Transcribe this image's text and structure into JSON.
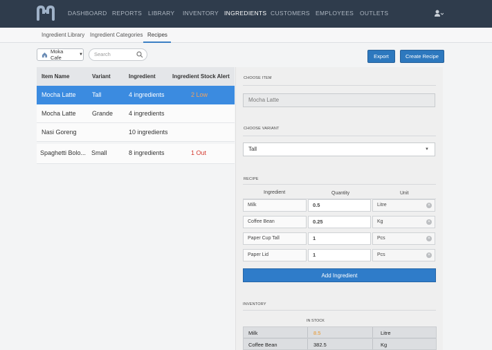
{
  "nav": {
    "items": [
      "DASHBOARD",
      "REPORTS",
      "LIBRARY",
      "INVENTORY",
      "INGREDIENTS",
      "CUSTOMERS",
      "EMPLOYEES",
      "OUTLETS"
    ],
    "active": "INGREDIENTS"
  },
  "subnav": {
    "items": [
      "Ingredient Library",
      "Ingredient Categories",
      "Recipes"
    ],
    "active": "Recipes"
  },
  "toolbar": {
    "outlet": "Moka Cafe",
    "search_placeholder": "Search",
    "export_label": "Export",
    "create_label": "Create Recipe"
  },
  "table": {
    "headers": [
      "Item Name",
      "Variant",
      "Ingredient",
      "Ingredient Stock Alert"
    ],
    "rows": [
      {
        "item": "Mocha Latte",
        "variant": "Tall",
        "ingredient": "4 ingredients",
        "alert": "2 Low"
      },
      {
        "item": "Mocha Latte",
        "variant": "Grande",
        "ingredient": "4 ingredients",
        "alert": ""
      },
      {
        "item": "Nasi Goreng",
        "variant": "",
        "ingredient": "10 ingredients",
        "alert": ""
      },
      {
        "item": "Spaghetti Bolo...",
        "variant": "Small",
        "ingredient": "8 ingredients",
        "alert": "1 Out"
      }
    ]
  },
  "panel": {
    "choose_item_label": "CHOOSE ITEM",
    "item_value": "Mocha Latte",
    "choose_variant_label": "CHOOSE VARIANT",
    "variant_value": "Tall",
    "recipe_label": "RECIPE",
    "recipe_headers": [
      "Ingredient",
      "Quantity",
      "Unit"
    ],
    "recipe_rows": [
      {
        "ingredient": "Milk",
        "qty": "0.5",
        "unit": "Litre"
      },
      {
        "ingredient": "Coffee Bean",
        "qty": "0.25",
        "unit": "Kg"
      },
      {
        "ingredient": "Paper Cup Tall",
        "qty": "1",
        "unit": "Pcs"
      },
      {
        "ingredient": "Paper Lid",
        "qty": "1",
        "unit": "Pcs"
      }
    ],
    "add_label": "Add Ingredient",
    "inventory_label": "INVENTORY",
    "in_stock_label": "IN STOCK",
    "inventory_rows": [
      {
        "name": "Milk",
        "stock": "8.5",
        "unit": "Litre"
      },
      {
        "name": "Coffee Bean",
        "stock": "382.5",
        "unit": "Kg"
      }
    ]
  },
  "colors": {
    "nav_bg": "#2f3c4c",
    "accent": "#2d78be",
    "selected_row": "#3b8be0",
    "alert_red": "#d43a2f",
    "low_orange": "#e8962a"
  }
}
